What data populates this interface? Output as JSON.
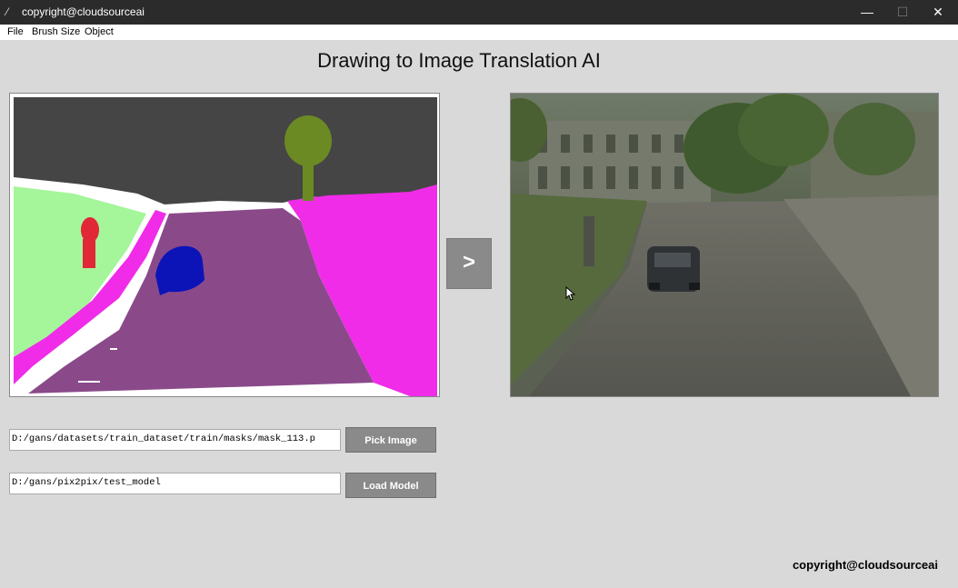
{
  "window": {
    "title": "copyright@cloudsourceai",
    "controls": {
      "minimize": "—",
      "maximize": "☐",
      "close": "✕"
    }
  },
  "menu": {
    "items": [
      "File",
      "Brush Size",
      "Object"
    ]
  },
  "heading": "Drawing to Image Translation AI",
  "translate_button": {
    "label": ">"
  },
  "image_path": {
    "value": "D:/gans/datasets/train_dataset/train/masks/mask_113.p"
  },
  "pick_button": {
    "label": "Pick Image"
  },
  "model_path": {
    "value": "D:/gans/pix2pix/test_model"
  },
  "load_button": {
    "label": "Load Model"
  },
  "footer": "copyright@cloudsourceai",
  "colors": {
    "sky": "#454545",
    "road": "#8a4a8a",
    "sidewalk": "#f02ce8",
    "grass": "#a5f59a",
    "tree_foliage": "#6b8a24",
    "person": "#e02836",
    "car": "#0c14b8",
    "button": "#8a8a8a"
  }
}
